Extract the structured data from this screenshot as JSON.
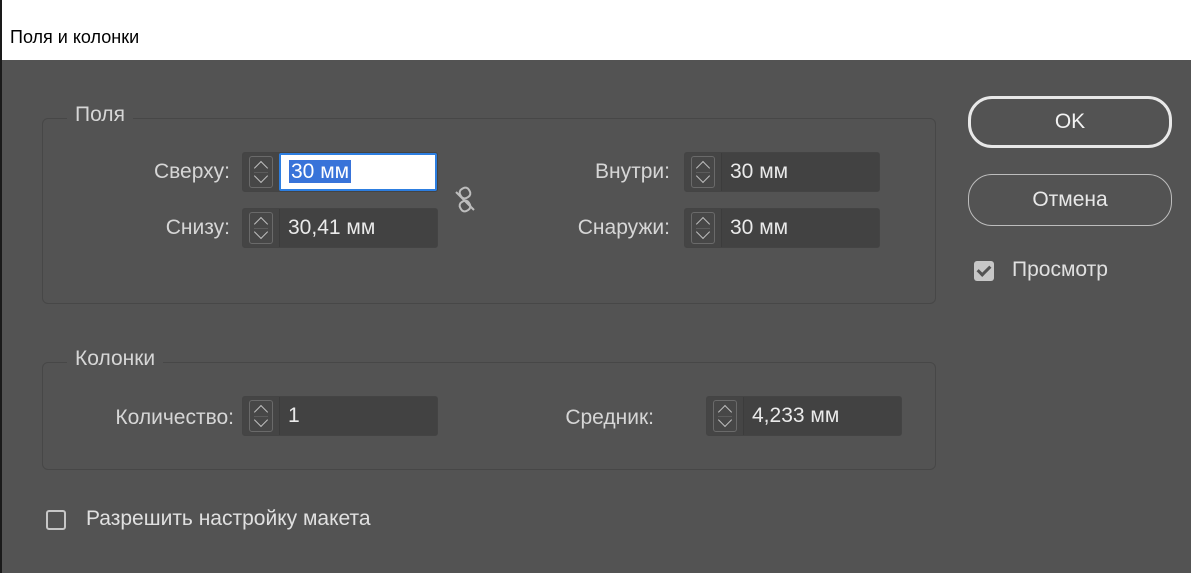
{
  "window": {
    "title": "Поля и колонки"
  },
  "margins": {
    "group_label": "Поля",
    "top": {
      "label": "Сверху:",
      "value": "30 мм"
    },
    "bottom": {
      "label": "Снизу:",
      "value": "30,41 мм"
    },
    "inside": {
      "label": "Внутри:",
      "value": "30 мм"
    },
    "outside": {
      "label": "Снаружи:",
      "value": "30 мм"
    },
    "link_icon": "unlink-chain-icon"
  },
  "columns": {
    "group_label": "Колонки",
    "count": {
      "label": "Количество:",
      "value": "1"
    },
    "gutter": {
      "label": "Средник:",
      "value": "4,233 мм"
    }
  },
  "buttons": {
    "ok": "OK",
    "cancel": "Отмена"
  },
  "preview": {
    "label": "Просмотр",
    "checked": true
  },
  "enable_layout_adjustment": {
    "label": "Разрешить настройку макета",
    "checked": false
  },
  "colors": {
    "dialog_bg": "#535353",
    "selection": "#3873d9",
    "focus_border": "#2d7ee0"
  }
}
